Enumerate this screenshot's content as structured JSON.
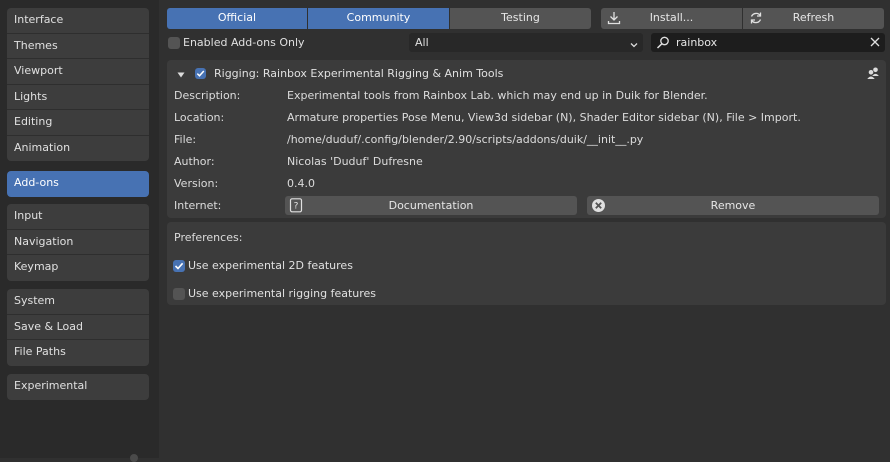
{
  "sidebar": {
    "groups": [
      [
        "Interface",
        "Themes",
        "Viewport",
        "Lights",
        "Editing",
        "Animation"
      ],
      [
        "Add-ons"
      ],
      [
        "Input",
        "Navigation",
        "Keymap"
      ],
      [
        "System",
        "Save & Load",
        "File Paths"
      ],
      [
        "Experimental"
      ]
    ],
    "active": "Add-ons"
  },
  "toolbar": {
    "tabs": [
      "Official",
      "Community",
      "Testing"
    ],
    "active_tabs": [
      "Official",
      "Community"
    ],
    "install_label": "Install...",
    "refresh_label": "Refresh"
  },
  "filter": {
    "enabled_only_label": "Enabled Add-ons Only",
    "enabled_only_checked": false,
    "category_value": "All",
    "search_value": "rainbox"
  },
  "addon": {
    "enabled": true,
    "title": "Rigging: Rainbox Experimental Rigging & Anim Tools",
    "description_label": "Description:",
    "description": "Experimental tools from Rainbox Lab. which may end up in Duik for Blender.",
    "location_label": "Location:",
    "location": "Armature properties Pose Menu, View3d sidebar (N), Shader Editor sidebar (N), File > Import.",
    "file_label": "File:",
    "file": "/home/duduf/.config/blender/2.90/scripts/addons/duik/__init__.py",
    "author_label": "Author:",
    "author": "Nicolas 'Duduf' Dufresne",
    "version_label": "Version:",
    "version": "0.4.0",
    "internet_label": "Internet:",
    "documentation_label": "Documentation",
    "remove_label": "Remove"
  },
  "preferences": {
    "label": "Preferences:",
    "options": [
      {
        "label": "Use experimental 2D features",
        "checked": true
      },
      {
        "label": "Use experimental rigging features",
        "checked": false
      }
    ]
  },
  "colors": {
    "accent": "#4772b3",
    "background": "#303030",
    "sidebar": "#2a2a2a",
    "panel": "#3b3b3b",
    "button": "#545454"
  }
}
